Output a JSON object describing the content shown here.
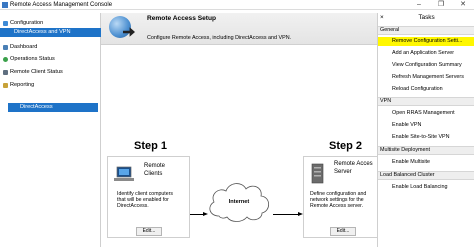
{
  "window": {
    "title": "Remote Access Management Console"
  },
  "nav": {
    "items": [
      {
        "label": "Configuration"
      },
      {
        "label": "DirectAccess and VPN"
      },
      {
        "label": "Dashboard"
      },
      {
        "label": "Operations Status"
      },
      {
        "label": "Remote Client Status"
      },
      {
        "label": "Reporting"
      },
      {
        "label": "DirectAccess"
      }
    ]
  },
  "banner": {
    "title": "Remote Access Setup",
    "subtitle": "Configure Remote Access, including DirectAccess and VPN."
  },
  "steps": [
    {
      "label": "Step 1",
      "title_line1": "Remote",
      "title_line2": "Clients",
      "desc_line1": "Identify client computers",
      "desc_line2": "that will be enabled for",
      "desc_line3": "DirectAccess.",
      "edit": "Edit..."
    },
    {
      "label": "Step 2",
      "title_line1": "Remote Acces",
      "title_line2": "Server",
      "desc_line1": "Define configuration and",
      "desc_line2": "network settings for the",
      "desc_line3": "Remote Access server.",
      "edit": "Edit..."
    }
  ],
  "cloud": {
    "label": "Internet"
  },
  "tasks": {
    "title": "Tasks",
    "sections": [
      {
        "label": "General"
      },
      {
        "label": "VPN"
      },
      {
        "label": "Multisite Deployment"
      },
      {
        "label": "Load Balanced Cluster"
      }
    ],
    "items": [
      "Remove Configuration Setti...",
      "Add an Application Server",
      "View Configuration Summary",
      "Refresh Management Servers",
      "Reload Configuration",
      "Open RRAS Management",
      "Enable VPN",
      "Enable Site-to-Site VPN",
      "Enable Multisite",
      "Enable Load Balancing"
    ]
  },
  "colors": {
    "selection": "#1e73c8",
    "highlight": "#fff700"
  }
}
